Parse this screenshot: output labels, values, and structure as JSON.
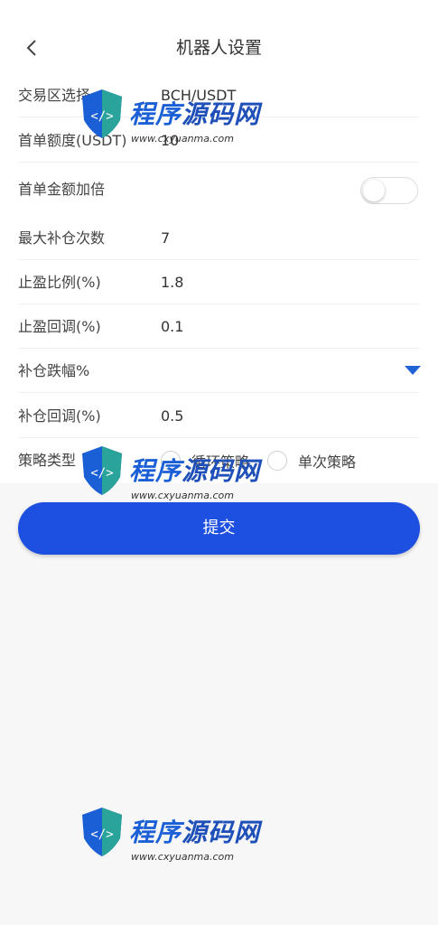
{
  "header": {
    "title": "机器人设置",
    "back_icon": "chevron-left-icon"
  },
  "form": {
    "exchange_label": "交易区选择",
    "exchange_value": "BCH/USDT",
    "first_amount_label": "首单额度(USDT)",
    "first_amount_value": "10",
    "double_label": "首单金额加倍",
    "double_on": false,
    "max_add_label": "最大补仓次数",
    "max_add_value": "7",
    "take_profit_label": "止盈比例(%)",
    "take_profit_value": "1.8",
    "tp_callback_label": "止盈回调(%)",
    "tp_callback_value": "0.1",
    "add_drop_label": "补仓跌幅%",
    "add_callback_label": "补仓回调(%)",
    "add_callback_value": "0.5",
    "strategy_label": "策略类型",
    "strategy_options": [
      "循环策略",
      "单次策略"
    ]
  },
  "submit_label": "提交",
  "watermark": {
    "text_main": "程序",
    "text_accent": "源码网",
    "text_sub": "www.cxyuanma.com"
  },
  "colors": {
    "primary": "#1d4fe0",
    "arrow": "#1f63d6"
  }
}
